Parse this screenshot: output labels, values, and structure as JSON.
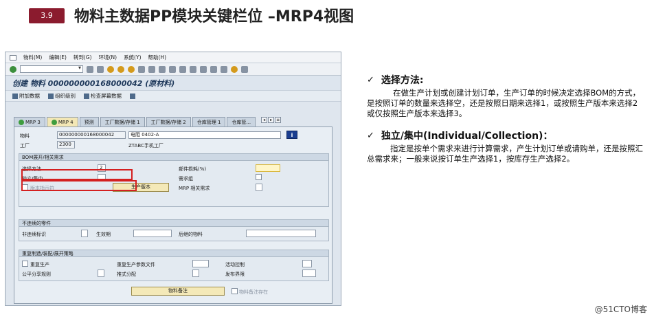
{
  "slide": {
    "badge": "3.9",
    "title": "物料主数据PP模块关键栏位 –MRP4视图"
  },
  "sap": {
    "menu": [
      "物料(M)",
      "编辑(E)",
      "转到(G)",
      "环境(N)",
      "系统(Y)",
      "帮助(H)"
    ],
    "window_title": "创建 物料 000000000168000042 (原材料)",
    "app_toolbar": [
      "附加数据",
      "组织级别",
      "检查屏幕数据"
    ],
    "tabs": [
      {
        "label": "MRP 3",
        "active": false,
        "checked": true
      },
      {
        "label": "MRP 4",
        "active": true,
        "checked": true
      },
      {
        "label": "预测",
        "active": false,
        "checked": false
      },
      {
        "label": "工厂数据/存储 1",
        "active": false,
        "checked": false
      },
      {
        "label": "工厂数据/存储 2",
        "active": false,
        "checked": false
      },
      {
        "label": "仓库管理 1",
        "active": false,
        "checked": false
      },
      {
        "label": "仓库管...",
        "active": false,
        "checked": false
      }
    ],
    "header": {
      "material_label": "物料",
      "material_value": "000000000168000042",
      "material_desc": "电阻 0402-A",
      "plant_label": "工厂",
      "plant_value": "2300",
      "plant_desc": "ZTABC手机工厂",
      "info_label": "i"
    },
    "bom_group": {
      "title": "BOM展开/相关需求",
      "selection_method_label": "选择方法",
      "selection_method_value": "2",
      "indiv_coll_label": "独立/集中",
      "version_indicator_label": "版本指示符",
      "production_version_button": "生产版本",
      "component_scrap_label": "部件损耗(%)",
      "requirements_group_label": "需求组",
      "mrp_dep_req_label": "MRP 相关需求"
    },
    "discontinued_group": {
      "title": "不连续的零件",
      "discontinued_indicator_label": "非连续标识",
      "effective_out_label": "生效期",
      "follow_up_material_label": "后继的物料"
    },
    "repetitive_group": {
      "title": "重复制造/装配/展开策略",
      "repetitive_mfg_label": "重复生产",
      "rem_profile_label": "重复生产参数文件",
      "action_control_label": "活动控制",
      "fair_share_label": "公平分享规则",
      "push_distribution_label": "推式分配",
      "deployment_horizon_label": "发布界限"
    },
    "footer": {
      "material_memo_button": "物料备注",
      "memo_exists_label": "物料备注存在"
    }
  },
  "notes": [
    {
      "heading": "选择方法:",
      "body": "在做生产计划或创建计划订单，生产订单的时候决定选择BOM的方式，是按照订单的数量来选择空，还是按照日期来选择1，或按照生产版本来选择2或仅按照生产版本来选择3。"
    },
    {
      "heading": "独立/集中(Individual/Collection)：",
      "body": "指定是按单个需求来进行计算需求，产生计划订单或请购单，还是按照汇总需求来；一般来说按订单生产选择1，按库存生产选择2。"
    }
  ],
  "watermark": "@51CTO博客",
  "colors": {
    "badge": "#8b1b2e",
    "highlight": "#d42020",
    "sap_bg": "#dfe6ee"
  }
}
